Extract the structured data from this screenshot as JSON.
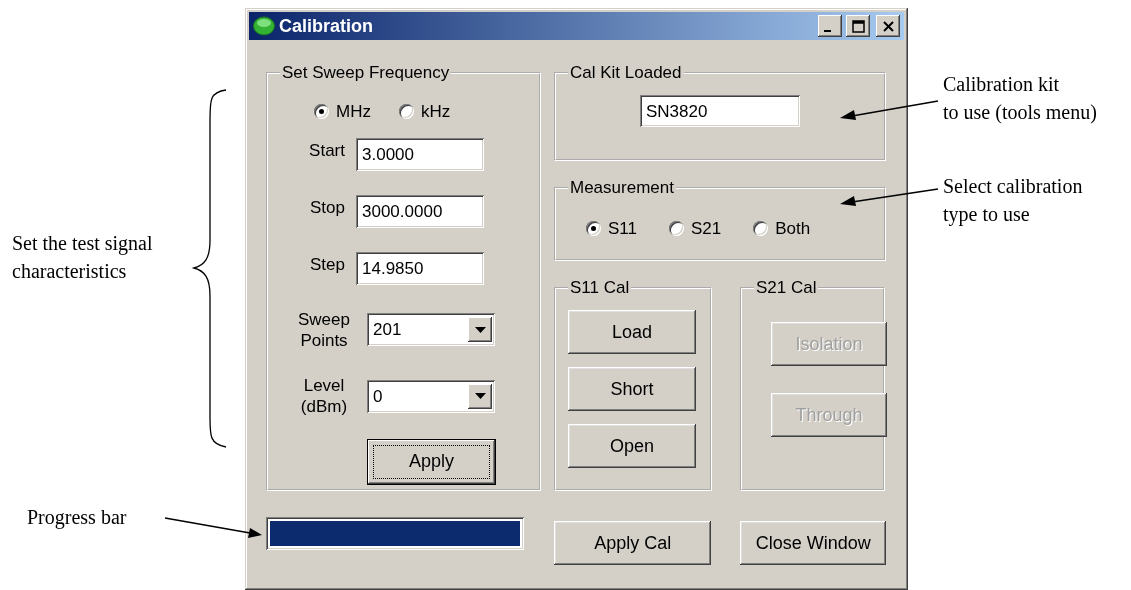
{
  "window": {
    "title": "Calibration"
  },
  "sweep": {
    "legend": "Set Sweep Frequency",
    "units": [
      {
        "label": "MHz",
        "selected": true
      },
      {
        "label": "kHz",
        "selected": false
      }
    ],
    "fields": [
      {
        "kind": "text",
        "label": "Start",
        "value": "3.0000"
      },
      {
        "kind": "text",
        "label": "Stop",
        "value": "3000.0000"
      },
      {
        "kind": "text",
        "label": "Step",
        "value": "14.9850"
      },
      {
        "kind": "combo",
        "label": "Sweep Points",
        "value": "201"
      },
      {
        "kind": "combo",
        "label": "Level (dBm)",
        "value": "0"
      }
    ],
    "apply": {
      "label": "Apply",
      "focused": true
    }
  },
  "cal_kit": {
    "legend": "Cal Kit Loaded",
    "value": "SN3820"
  },
  "measurement": {
    "legend": "Measurement",
    "options": [
      {
        "label": "S11",
        "selected": true
      },
      {
        "label": "S21",
        "selected": false
      },
      {
        "label": "Both",
        "selected": false
      }
    ]
  },
  "s11_cal": {
    "legend": "S11 Cal",
    "buttons": [
      {
        "label": "Load",
        "disabled": false
      },
      {
        "label": "Short",
        "disabled": false
      },
      {
        "label": "Open",
        "disabled": false
      }
    ]
  },
  "s21_cal": {
    "legend": "S21 Cal",
    "buttons": [
      {
        "label": "Isolation",
        "disabled": true
      },
      {
        "label": "Through",
        "disabled": true
      }
    ]
  },
  "progress": {
    "level": 1
  },
  "footer_buttons": [
    {
      "label": "Apply Cal"
    },
    {
      "label": "Close Window"
    }
  ],
  "annotations": [
    {
      "lines": [
        "Calibration kit",
        "to use (tools menu)"
      ]
    },
    {
      "lines": [
        "Select calibration",
        "type to use"
      ]
    },
    {
      "lines": [
        "Set the test signal",
        "characteristics"
      ]
    },
    {
      "lines": [
        "Progress bar"
      ]
    }
  ]
}
